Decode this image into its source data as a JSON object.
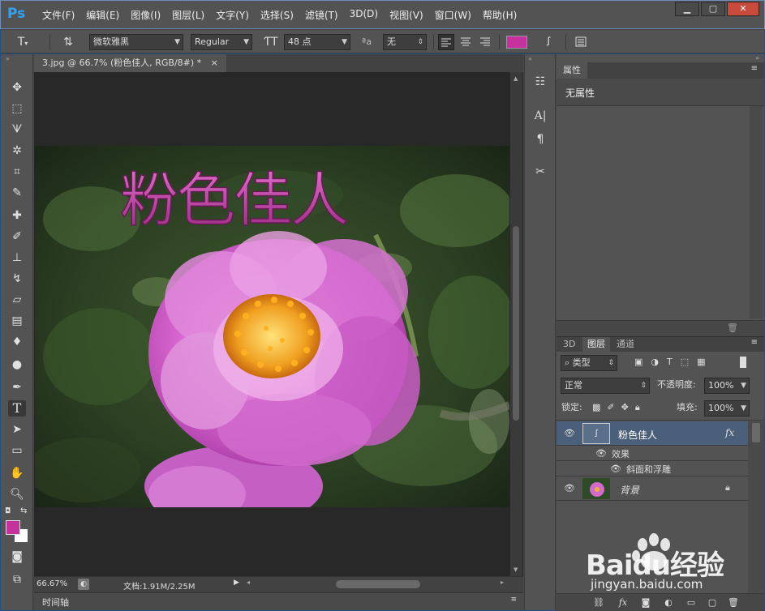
{
  "app": {
    "logo": "Ps"
  },
  "menu": [
    "文件(F)",
    "编辑(E)",
    "图像(I)",
    "图层(L)",
    "文字(Y)",
    "选择(S)",
    "滤镜(T)",
    "3D(D)",
    "视图(V)",
    "窗口(W)",
    "帮助(H)"
  ],
  "window_controls": {
    "minimize": "▁",
    "maximize": "▢",
    "close": "✕"
  },
  "options": {
    "font_family": "微软雅黑",
    "font_style": "Regular",
    "font_size": "48 点",
    "aa_label": "ªa",
    "antialias": "无",
    "text_color": "#c4309c"
  },
  "document": {
    "tab_title": "3.jpg @ 66.7% (粉色佳人, RGB/8#) *",
    "tab_close": "×",
    "canvas_text": "粉色佳人",
    "zoom": "66.67%",
    "doc_info": "文档:1.91M/2.25M",
    "timeline": "时间轴"
  },
  "properties_panel": {
    "tab": "属性",
    "content": "无属性"
  },
  "layers_panel": {
    "tabs": [
      "3D",
      "图层",
      "通道"
    ],
    "filter_kind": "类型",
    "blend_mode": "正常",
    "opacity_label": "不透明度:",
    "opacity_value": "100%",
    "lock_label": "锁定:",
    "fill_label": "填充:",
    "fill_value": "100%",
    "layers": [
      {
        "name": "粉色佳人",
        "fx": "fx",
        "effects_label": "效果",
        "effect": "斜面和浮雕"
      },
      {
        "name": "背景"
      }
    ]
  },
  "watermark": {
    "brand": "Baidu经验",
    "url": "jingyan.baidu.com"
  },
  "colors": {
    "ui_bg": "#535353",
    "text_pink": "#c4309c",
    "accent_blue": "#2fa3f6"
  }
}
